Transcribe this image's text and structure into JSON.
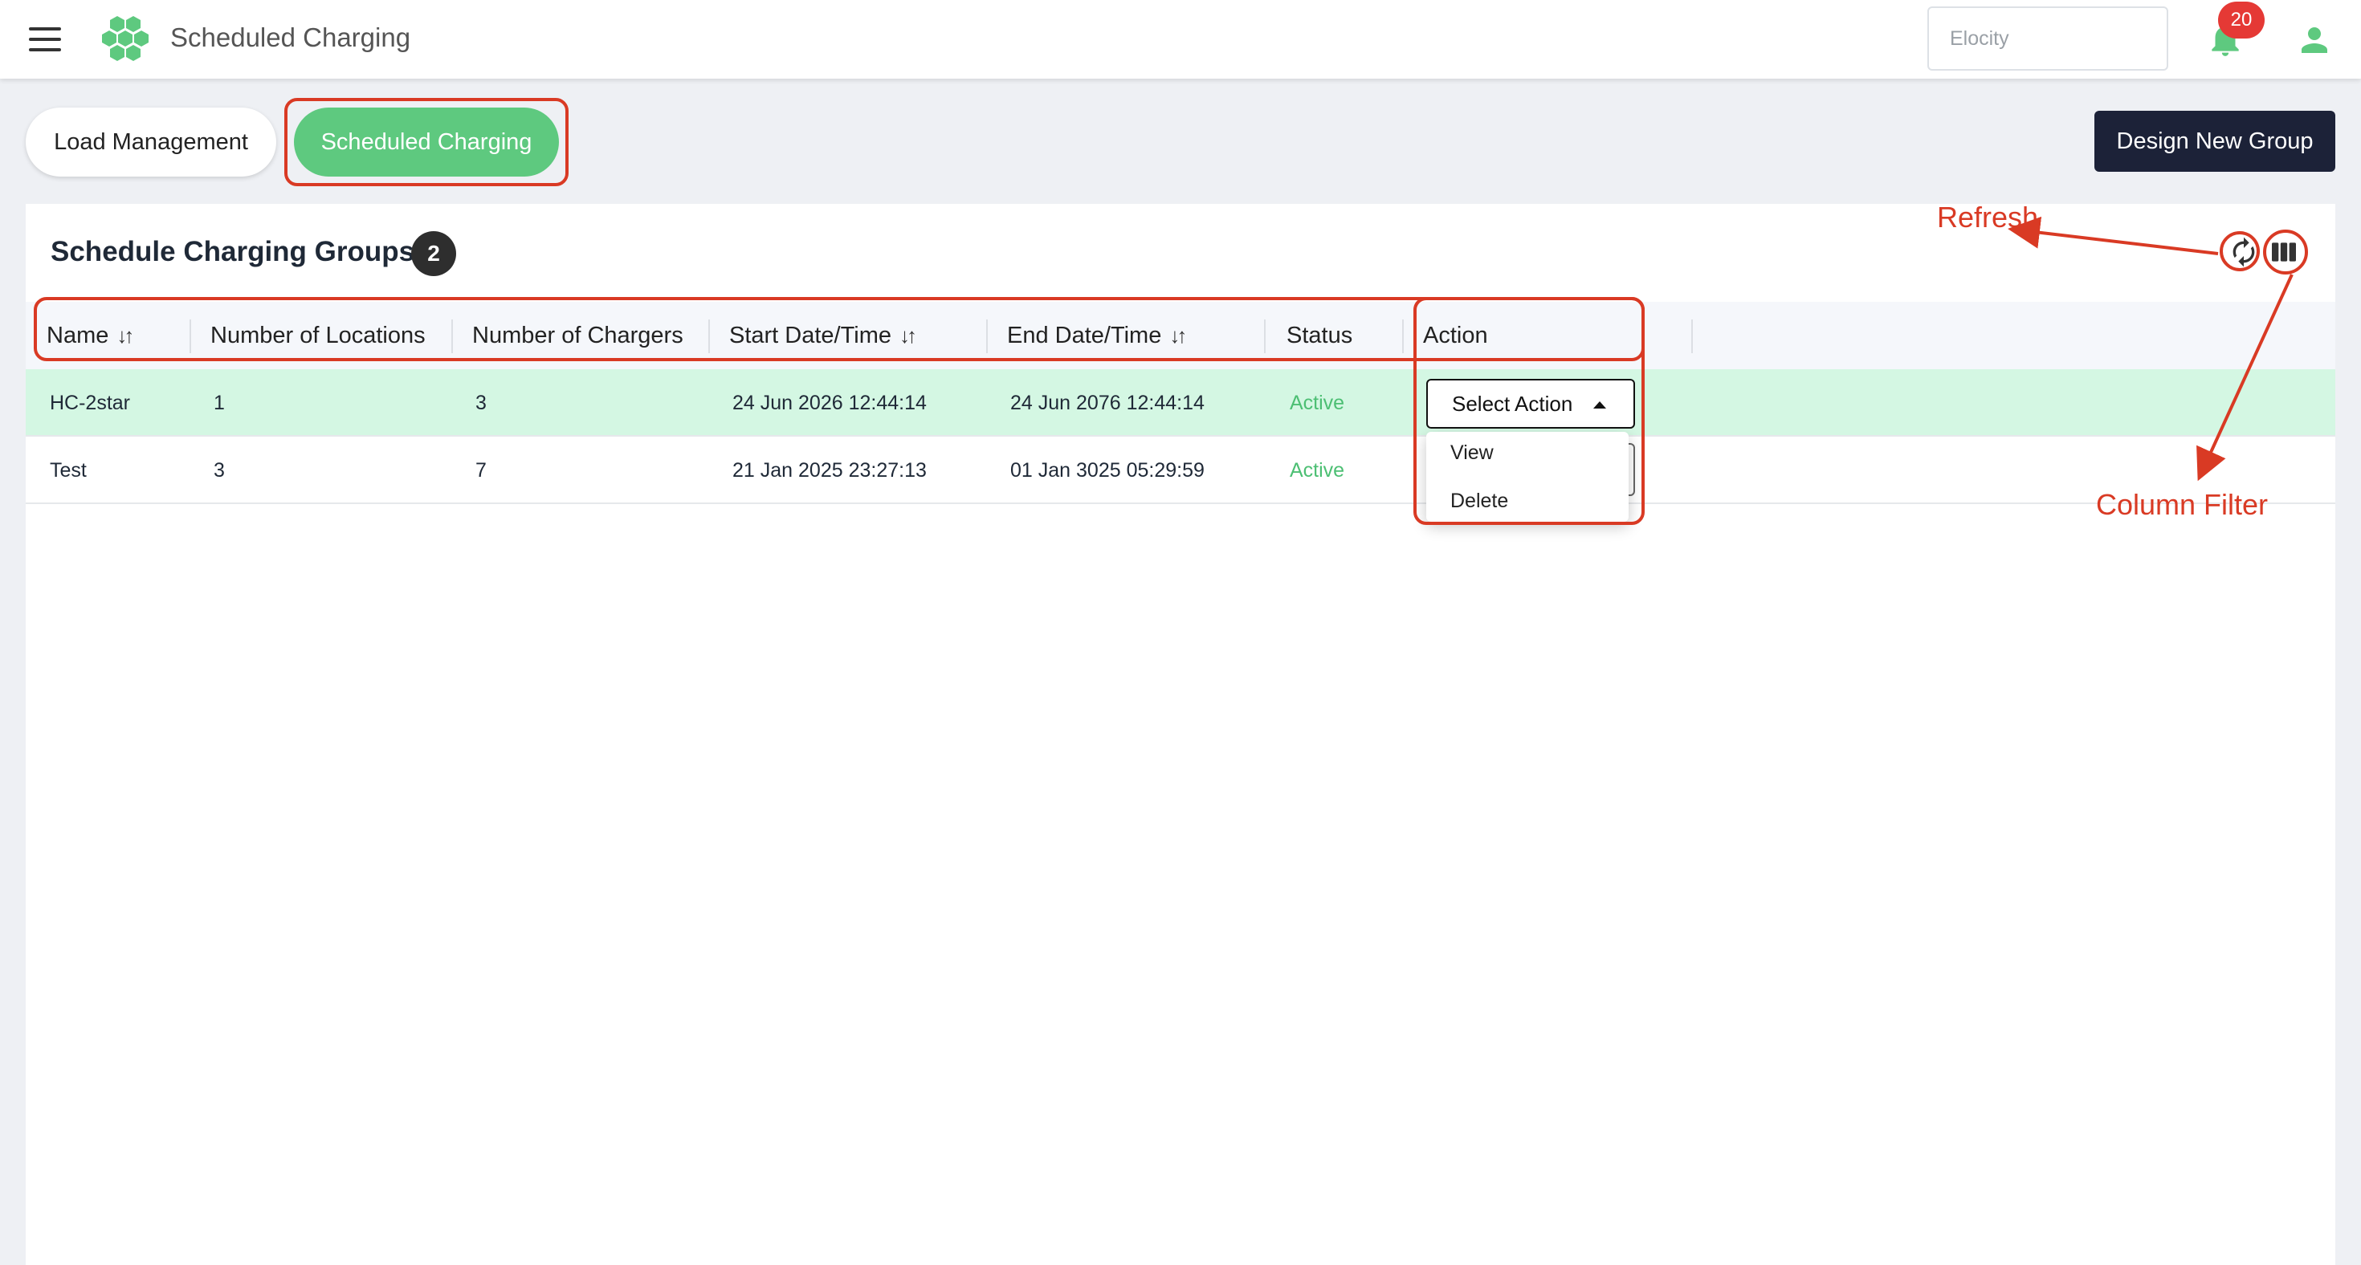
{
  "header": {
    "title": "Scheduled Charging",
    "org_placeholder": "Elocity",
    "notification_count": "20",
    "brand_color": "#5ec97f",
    "icons": [
      "menu-icon",
      "hexagon-logo",
      "bell-icon",
      "user-icon"
    ]
  },
  "tabs": [
    {
      "label": "Load Management",
      "active": false
    },
    {
      "label": "Scheduled Charging",
      "active": true
    }
  ],
  "design_button": "Design New Group",
  "card": {
    "title": "Schedule Charging Groups",
    "count": "2"
  },
  "table": {
    "columns": [
      {
        "label": "Name",
        "sortable": true
      },
      {
        "label": "Number of Locations",
        "sortable": false
      },
      {
        "label": "Number of Chargers",
        "sortable": false
      },
      {
        "label": "Start Date/Time",
        "sortable": true
      },
      {
        "label": "End Date/Time",
        "sortable": true
      },
      {
        "label": "Status",
        "sortable": false
      },
      {
        "label": "Action",
        "sortable": false
      }
    ],
    "sort_glyph": "↓↑",
    "rows": [
      {
        "name": "HC-2star",
        "locations": "1",
        "chargers": "3",
        "start": "24 Jun 2026 12:44:14",
        "end": "24 Jun 2076 12:44:14",
        "status": "Active",
        "highlighted": true
      },
      {
        "name": "Test",
        "locations": "3",
        "chargers": "7",
        "start": "21 Jan 2025 23:27:13",
        "end": "01 Jan 3025 05:29:59",
        "status": "Active",
        "highlighted": false
      }
    ],
    "select_action_label": "Select Action",
    "dropdown_options": [
      "View",
      "Delete"
    ]
  },
  "annotations": {
    "refresh_label": "Refresh",
    "column_filter_label": "Column Filter",
    "color": "#d93a24"
  }
}
